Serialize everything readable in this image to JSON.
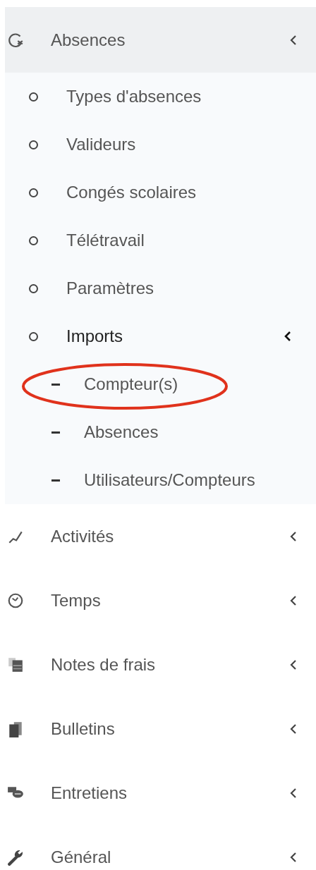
{
  "menu": [
    {
      "label": "Absences",
      "expanded": true,
      "children": [
        {
          "label": "Types d'absences",
          "selected": false
        },
        {
          "label": "Valideurs",
          "selected": false
        },
        {
          "label": "Congés scolaires",
          "selected": false
        },
        {
          "label": "Télétravail",
          "selected": false
        },
        {
          "label": "Paramètres",
          "selected": false
        },
        {
          "label": "Imports",
          "selected": true,
          "expanded": true,
          "children": [
            {
              "label": "Compteur(s)",
              "circled": true
            },
            {
              "label": "Absences",
              "circled": false
            },
            {
              "label": "Utilisateurs/Compteurs",
              "circled": false
            }
          ]
        }
      ]
    },
    {
      "label": "Activités",
      "expanded": false
    },
    {
      "label": "Temps",
      "expanded": false
    },
    {
      "label": "Notes de frais",
      "expanded": false
    },
    {
      "label": "Bulletins",
      "expanded": false
    },
    {
      "label": "Entretiens",
      "expanded": false
    },
    {
      "label": "Général",
      "expanded": false
    }
  ]
}
